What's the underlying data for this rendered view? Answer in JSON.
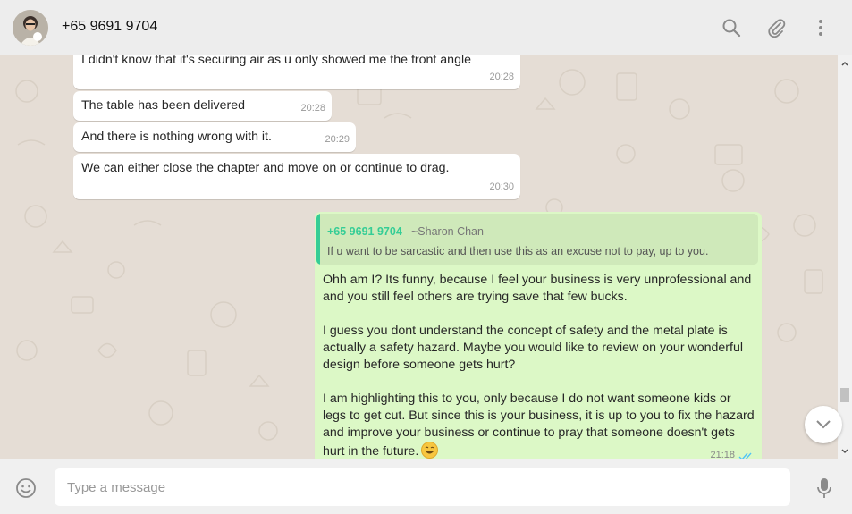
{
  "header": {
    "contact_name": "+65 9691 9704"
  },
  "messages": [
    {
      "text": "I didn't know that it's securing air as u only showed me the front angle",
      "time": "20:28"
    },
    {
      "text": "The table has been delivered",
      "time": "20:28"
    },
    {
      "text": "And there is nothing wrong with it.",
      "time": "20:29"
    },
    {
      "text": "We can either close the chapter and move on or continue to drag.",
      "time": "20:30"
    }
  ],
  "outgoing": {
    "quote": {
      "sender_number": "+65 9691 9704",
      "sender_name": "~Sharon Chan",
      "text": "If u want to be sarcastic and then use this as an excuse not to pay, up to you."
    },
    "paragraphs": [
      "Ohh am I? Its funny, because I feel your business is very unprofessional and and you still feel others are trying save that few bucks.",
      "I guess you dont understand the concept of safety and the metal plate is actually a safety hazard. Maybe you would like to review on your wonderful design before someone gets hurt?",
      "I am highlighting this to you, only because I do not want someone kids or legs to get cut. But since this is your business, it is up to you to fix the hazard and improve your business or continue to pray that someone doesn't gets hurt in the future."
    ],
    "time": "21:18"
  },
  "composer": {
    "placeholder": "Type a message"
  },
  "colors": {
    "outgoing_bubble": "#dcf8c6",
    "quote_accent": "#35cd96",
    "read_ticks": "#4fc3f7"
  }
}
